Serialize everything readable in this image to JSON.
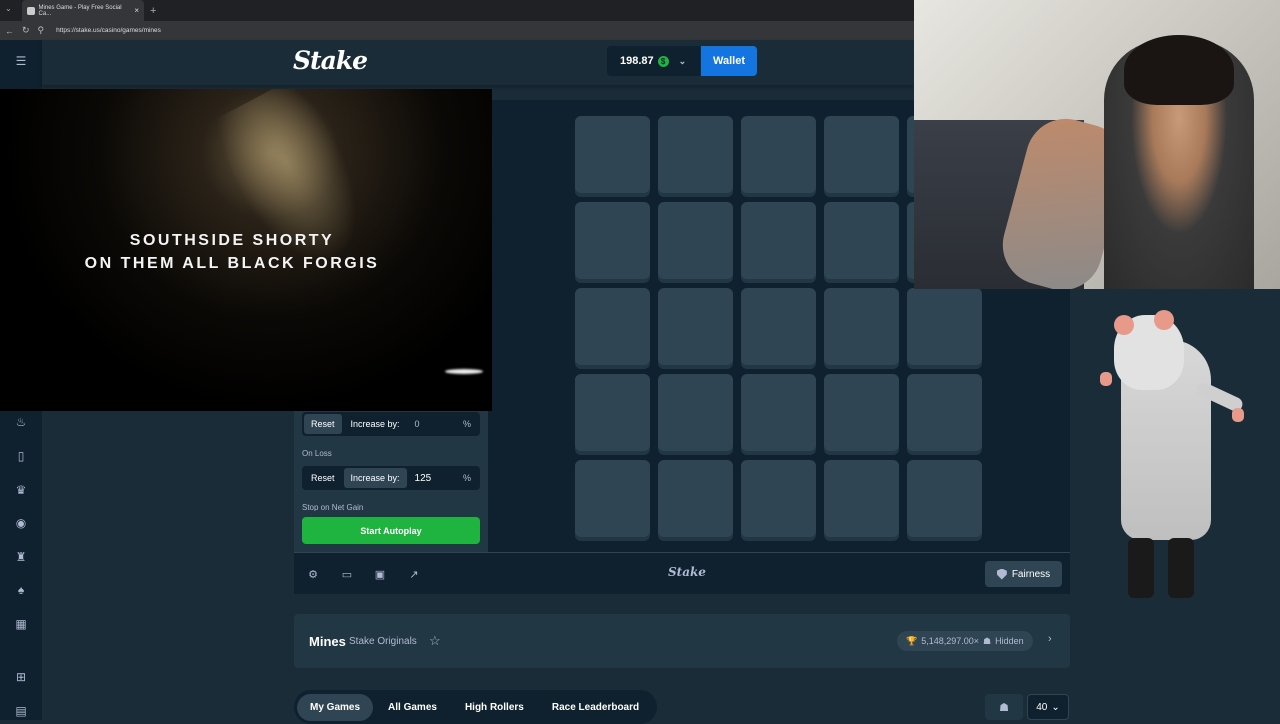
{
  "browser": {
    "tab_title": "Mines Game - Play Free Social Ca...",
    "tab_close": "×",
    "new_tab": "+",
    "url": "https://stake.us/casino/games/mines"
  },
  "header": {
    "logo": "Stake",
    "balance": "198.87",
    "currency_icon": "$",
    "wallet_label": "Wallet"
  },
  "video": {
    "lyric_line1": "SOUTHSIDE SHORTY",
    "lyric_line2": "ON THEM ALL BLACK FORGIS"
  },
  "autoplay": {
    "on_win": {
      "reset": "Reset",
      "increase": "Increase by:",
      "value": "0",
      "unit": "%"
    },
    "on_loss_label": "On Loss",
    "on_loss": {
      "reset": "Reset",
      "increase": "Increase by:",
      "value": "125",
      "unit": "%"
    },
    "stop_label": "Stop on Net Gain",
    "start_button": "Start Autoplay"
  },
  "footer": {
    "logo": "Stake",
    "fairness": "Fairness"
  },
  "info": {
    "game_name": "Mines",
    "provider": "Stake Originals",
    "max_win": "5,148,297.00×",
    "hidden": "Hidden"
  },
  "bottom_tabs": [
    "My Games",
    "All Games",
    "High Rollers",
    "Race Leaderboard"
  ],
  "page_size": "40",
  "colors": {
    "bg": "#1a2c38",
    "panel": "#213743",
    "tile": "#2f4553",
    "accent_green": "#1fb340",
    "accent_blue": "#1475e1"
  }
}
